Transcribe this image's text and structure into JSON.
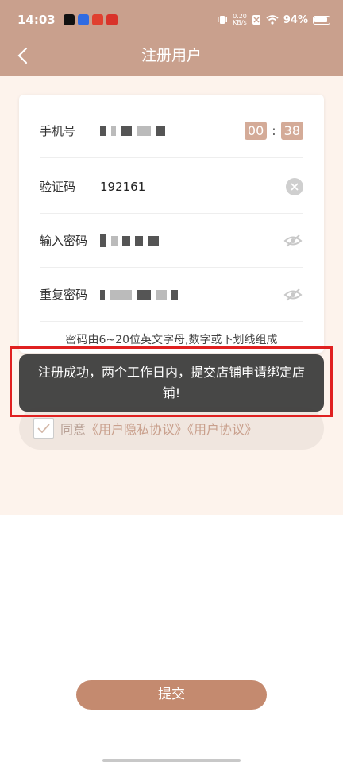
{
  "status_bar": {
    "time": "14:03",
    "net_speed_top": "0.20",
    "net_speed_bottom": "KB/s",
    "battery": "94%"
  },
  "header": {
    "title": "注册用户",
    "bg_color": "#c9a08d"
  },
  "form": {
    "phone_label": "手机号",
    "timer_minutes": "00",
    "timer_colon": ":",
    "timer_seconds": "38",
    "code_label": "验证码",
    "code_value": "192161",
    "password_label": "输入密码",
    "confirm_label": "重复密码",
    "hint": "密码由6~20位英文字母,数字或下划线组成"
  },
  "agreement": {
    "prefix": "同意",
    "link1": "《用户隐私协议》",
    "link2": "《用户协议》"
  },
  "toast": {
    "message": "注册成功，两个工作日内，提交店铺申请绑定店铺!"
  },
  "submit_label": "提交",
  "colors": {
    "accent": "#c48a6f",
    "highlight": "#e02020",
    "page_bg": "#fdf3ec"
  }
}
